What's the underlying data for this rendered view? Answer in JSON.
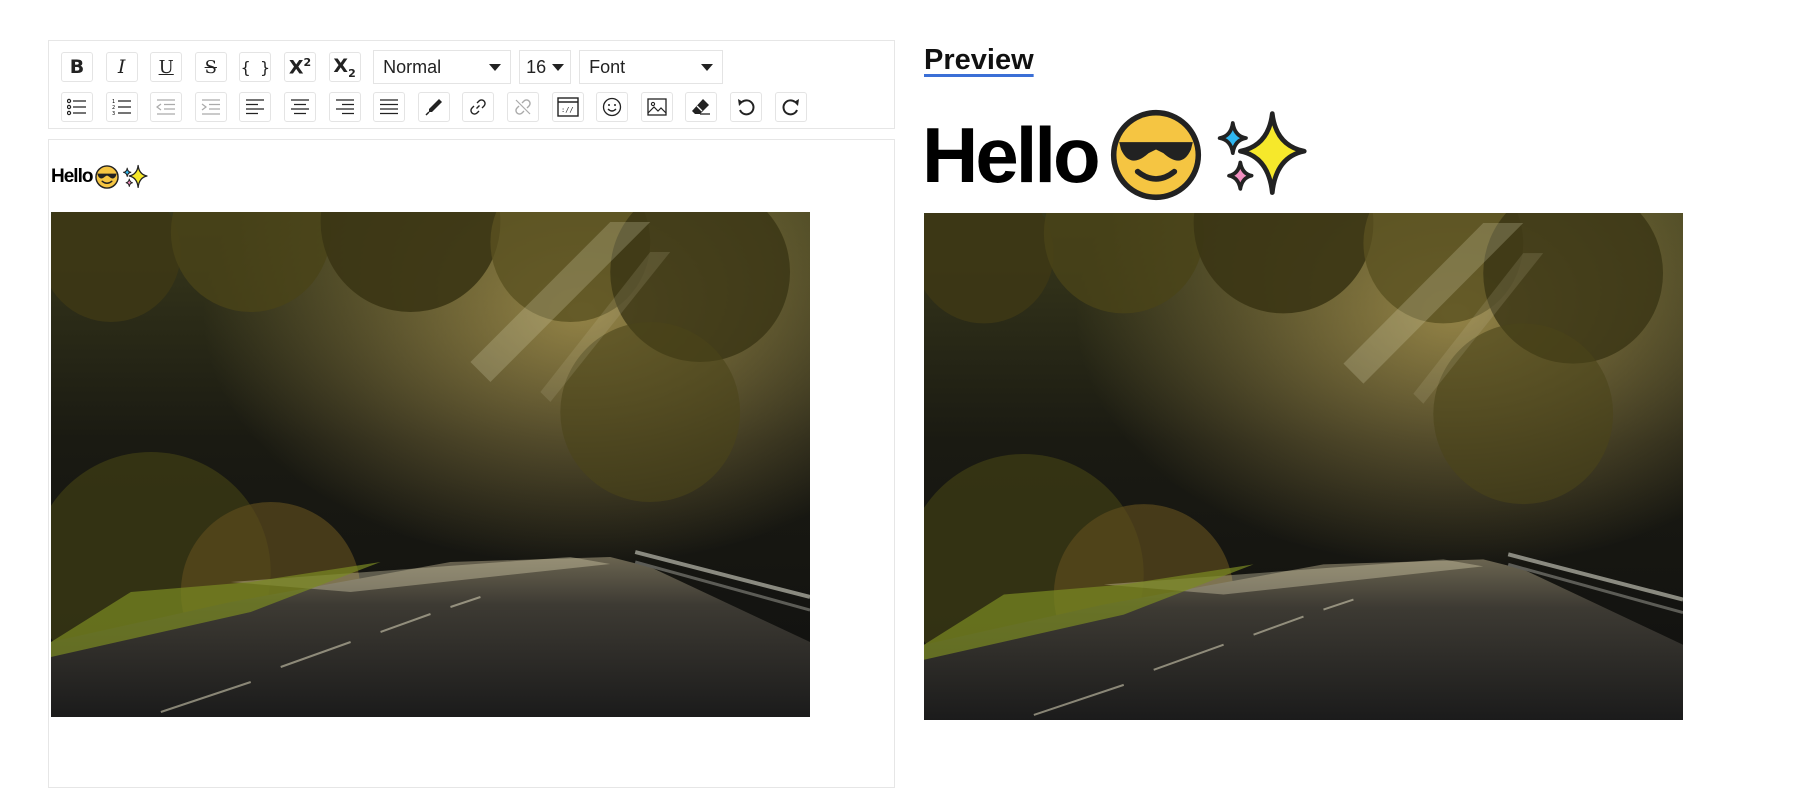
{
  "toolbar": {
    "block_format": "Normal",
    "font_size": "16",
    "font_family": "Font",
    "row1_icons": [
      "bold-icon",
      "italic-icon",
      "underline-icon",
      "strikethrough-icon",
      "code-icon",
      "superscript-icon",
      "subscript-icon"
    ],
    "row2_icons": [
      "bullet-list-icon",
      "numbered-list-icon",
      "outdent-icon",
      "indent-icon",
      "align-left-icon",
      "align-center-icon",
      "align-right-icon",
      "justify-icon",
      "color-picker-icon",
      "link-icon",
      "unlink-icon",
      "embed-icon",
      "emoji-icon",
      "image-icon",
      "eraser-icon",
      "undo-icon",
      "redo-icon"
    ],
    "labels": {
      "bold": "B",
      "italic": "I",
      "underline": "U",
      "strikethrough": "S",
      "code": "{ }",
      "superscript_base": "X",
      "superscript_mark": "2",
      "subscript_base": "X",
      "subscript_mark": "2"
    }
  },
  "editor": {
    "text": "Hello",
    "emojis": [
      "smiling-face-with-sunglasses-icon",
      "sparkles-icon"
    ]
  },
  "preview": {
    "title": "Preview",
    "text": "Hello"
  },
  "colors": {
    "accent": "#3b6fd6",
    "border": "#e6e6e6",
    "emoji_yellow": "#f5c542",
    "sparkle_blue": "#2fb7f0",
    "sparkle_pink": "#f28fc0"
  }
}
